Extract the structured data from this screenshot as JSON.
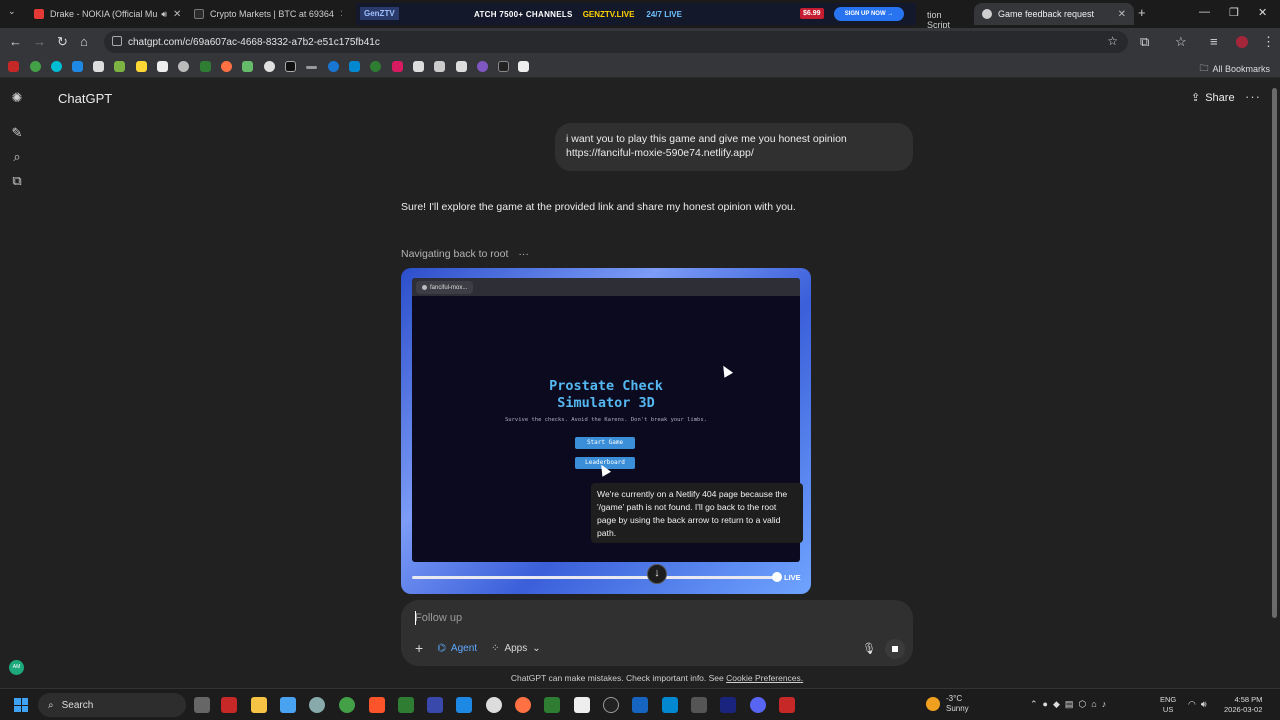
{
  "browser": {
    "tabs": [
      {
        "title": "Drake - NOKIA (Official Mu",
        "fav": "#e53935"
      },
      {
        "title": "Crypto Markets | BTC at 69364",
        "fav": "#2b2b2b"
      },
      {
        "title": "Game feedback request",
        "fav": "#cfcfcf"
      }
    ],
    "ad": {
      "channels": "ATCH 7500+ CHANNELS",
      "brand": "GENZTV.LIVE",
      "live": "24/7 LIVE",
      "price": "$6.99",
      "signup": "SIGN UP NOW →",
      "logo": "GenZTV",
      "trail": "tion Script"
    },
    "url": "chatgpt.com/c/69a607ac-4668-8332-a7b2-e51c175fb41c",
    "all_bookmarks": "All Bookmarks"
  },
  "app": {
    "name": "ChatGPT",
    "share": "Share",
    "user_message_line1": "i want you to play this game and give me  you honest opinion",
    "user_message_line2": "https://fanciful-moxie-590e74.netlify.app/",
    "assistant_reply": "Sure! I'll explore the game at the provided link and share my honest opinion with you.",
    "status": "Navigating back to root",
    "preview": {
      "tab_label": "fanciful-mox...",
      "title_line1": "Prostate Check",
      "title_line2": "Simulator 3D",
      "subtitle": "Survive the checks. Avoid the Karens. Don't break your limbs.",
      "button_start": "Start Game",
      "button_leaderboard": "Leaderboard",
      "tooltip": "We're currently on a Netlify 404 page because the '/game' path is not found. I'll go back to the root page by using the back arrow to return to a valid path.",
      "live_label": "LIVE",
      "progress_fraction": 0.99
    },
    "composer": {
      "placeholder": "Follow up",
      "agent": "Agent",
      "apps": "Apps"
    },
    "disclaimer": "ChatGPT can make mistakes. Check important info. See",
    "disclaimer_link": "Cookie Preferences.",
    "avatar": "AM"
  },
  "taskbar": {
    "search": "Search",
    "temp": "-3°C",
    "weather": "Sunny",
    "lang1": "ENG",
    "lang2": "US",
    "time": "4:58 PM",
    "date": "2026-03-02"
  }
}
